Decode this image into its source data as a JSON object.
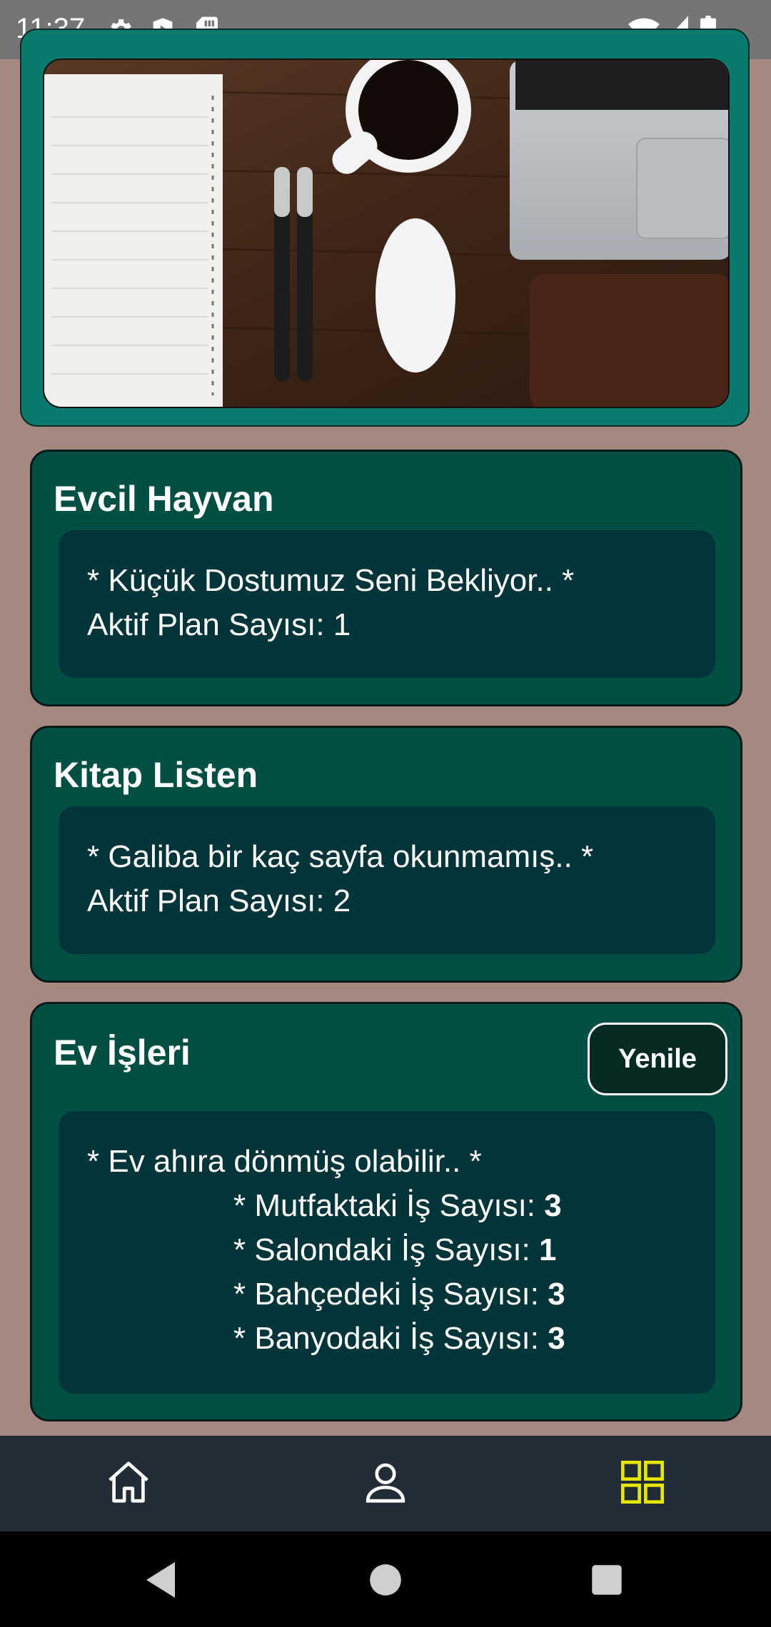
{
  "status_bar": {
    "time": "11:37"
  },
  "cards": [
    {
      "title": "Evcil Hayvan",
      "lines": [
        "* Küçük Dostumuz Seni Bekliyor.. *",
        "Aktif Plan Sayısı: 1"
      ]
    },
    {
      "title": "Kitap Listen",
      "lines": [
        "* Galiba bir kaç sayfa okunmamış.. *",
        "Aktif Plan Sayısı: 2"
      ]
    }
  ],
  "chores": {
    "title": "Ev İşleri",
    "refresh_label": "Yenile",
    "intro": "* Ev ahıra dönmüş olabilir.. *",
    "items": [
      {
        "label": "* Mutfaktaki İş Sayısı: ",
        "count": "3"
      },
      {
        "label": "* Salondaki İş Sayısı: ",
        "count": "1"
      },
      {
        "label": "* Bahçedeki İş Sayısı: ",
        "count": "3"
      },
      {
        "label": "* Banyodaki İş Sayısı: ",
        "count": "3"
      }
    ]
  },
  "colors": {
    "background": "#a5887f",
    "card": "#024f44",
    "inner": "#02353a",
    "active_nav": "#e6e600"
  },
  "icons": [
    "settings-icon",
    "play-protect-icon",
    "sd-card-icon",
    "wifi-icon",
    "signal-icon",
    "battery-icon",
    "home-icon",
    "profile-icon",
    "grid-icon",
    "back-icon",
    "home-circle-icon",
    "recents-icon"
  ]
}
